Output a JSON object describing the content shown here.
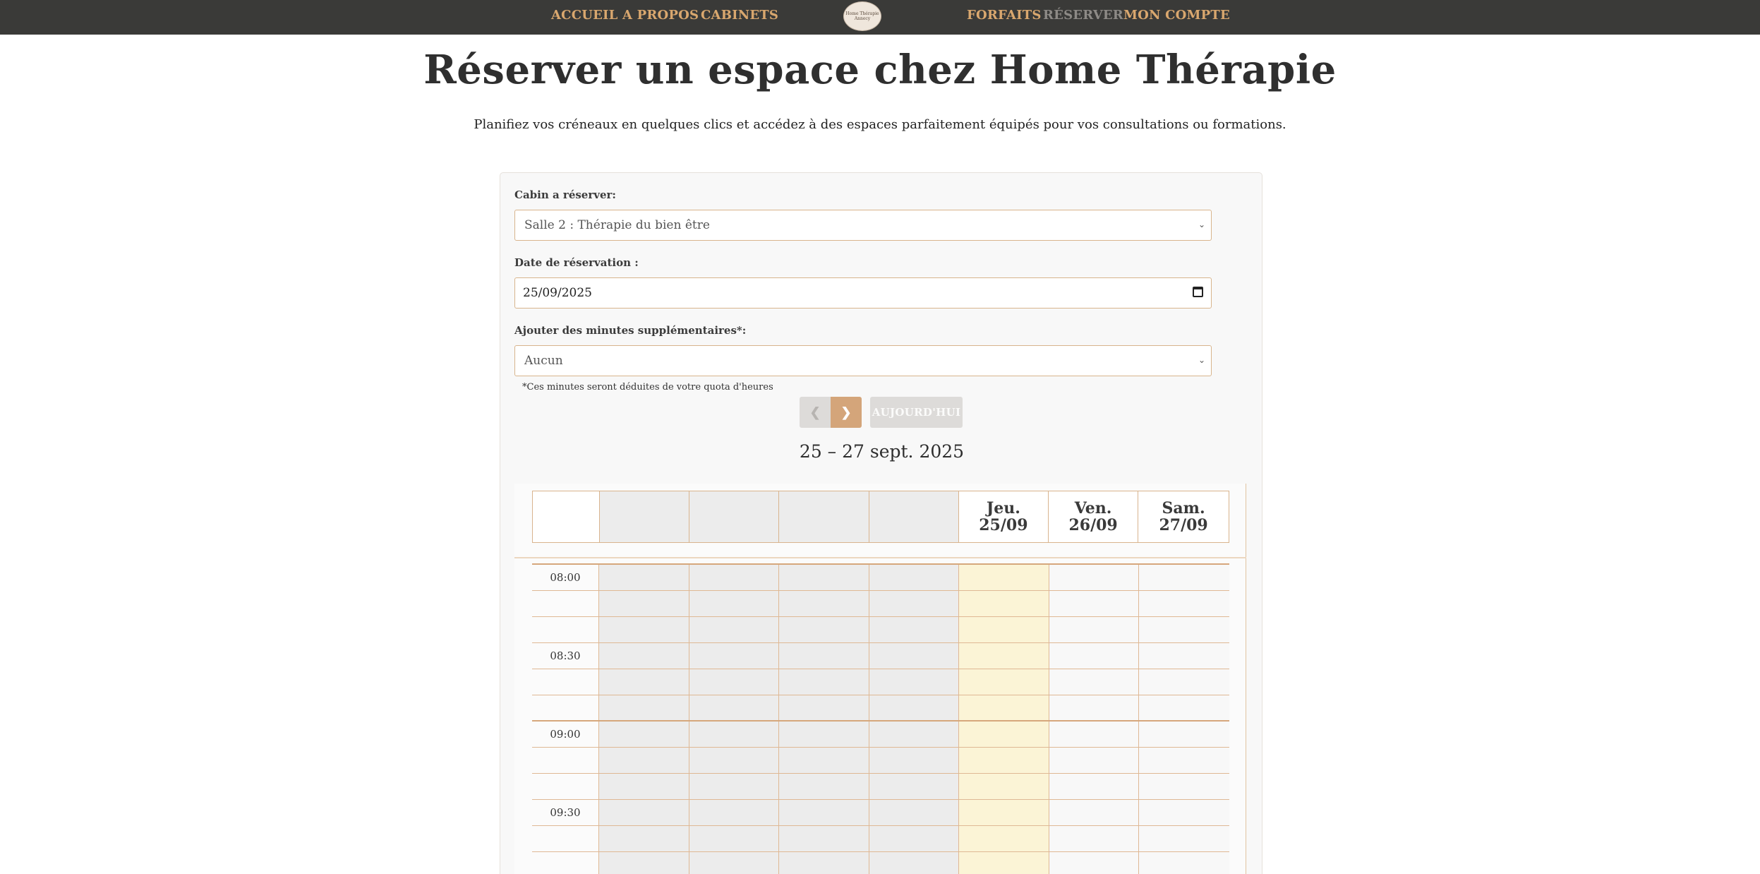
{
  "nav": {
    "left": [
      "ACCUEIL",
      "A PROPOS",
      "CABINETS"
    ],
    "right": [
      "FORFAITS",
      "RÉSERVER",
      "MON COMPTE"
    ],
    "logo_text": [
      "Home Thérapie",
      "Annecy"
    ],
    "active": "RÉSERVER"
  },
  "page": {
    "title": "Réserver un espace chez Home Thérapie",
    "subtitle": "Planifiez vos créneaux en quelques clics et accédez à des espaces parfaitement équipés pour vos consultations ou formations."
  },
  "form": {
    "cabin_label": "Cabin a réserver:",
    "cabin_value": "Salle 2 : Thérapie du bien être",
    "date_label": "Date de réservation :",
    "date_value": "25/09/2025",
    "minutes_label": "Ajouter des minutes supplémentaires*:",
    "minutes_value": "Aucun",
    "minutes_hint": "*Ces minutes seront déduites de votre quota d'heures"
  },
  "calendar": {
    "today_label": "AUJOURD'HUI",
    "prev_icon": "chevron-left-icon",
    "next_icon": "chevron-right-icon",
    "range": "25 – 27 sept. 2025",
    "days": [
      {
        "name": "",
        "date": ""
      },
      {
        "name": "",
        "date": ""
      },
      {
        "name": "",
        "date": ""
      },
      {
        "name": "",
        "date": ""
      },
      {
        "name": "Jeu.",
        "date": "25/09"
      },
      {
        "name": "Ven.",
        "date": "26/09"
      },
      {
        "name": "Sam.",
        "date": "27/09"
      }
    ],
    "times": [
      "08:00",
      "",
      "",
      "08:30",
      "",
      "",
      "09:00",
      "",
      "",
      "09:30",
      "",
      ""
    ]
  },
  "colors": {
    "nav_bg": "#3a3a38",
    "accent": "#d9a76e",
    "grid_line": "#dfb894",
    "today_bg": "#fbf4d6",
    "past_bg": "#ececec"
  }
}
